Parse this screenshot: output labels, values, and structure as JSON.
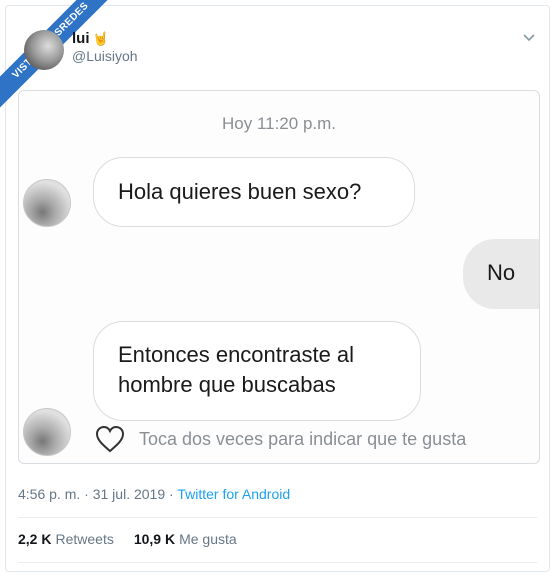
{
  "watermark": "VISTOENLASREDES",
  "tweet": {
    "display_name": "lui",
    "emoji": "🤘",
    "handle": "@Luisiyoh"
  },
  "chat": {
    "time": "Hoy 11:20 p.m.",
    "msg1": "Hola quieres buen sexo?",
    "msg2": "No",
    "msg3_line1": "Entonces encontraste al",
    "msg3_line2": "hombre que buscabas",
    "like_hint": "Toca dos veces para indicar que te gusta"
  },
  "meta": {
    "time": "4:56 p. m.",
    "dot1": "·",
    "date": "31 jul. 2019",
    "dot2": "·",
    "source": "Twitter for Android"
  },
  "stats": {
    "retweets_count": "2,2 K",
    "retweets_label": "Retweets",
    "likes_count": "10,9 K",
    "likes_label": "Me gusta"
  },
  "colors": {
    "ribbon": "#2e73c5",
    "link": "#1da1f2",
    "muted": "#657786"
  }
}
